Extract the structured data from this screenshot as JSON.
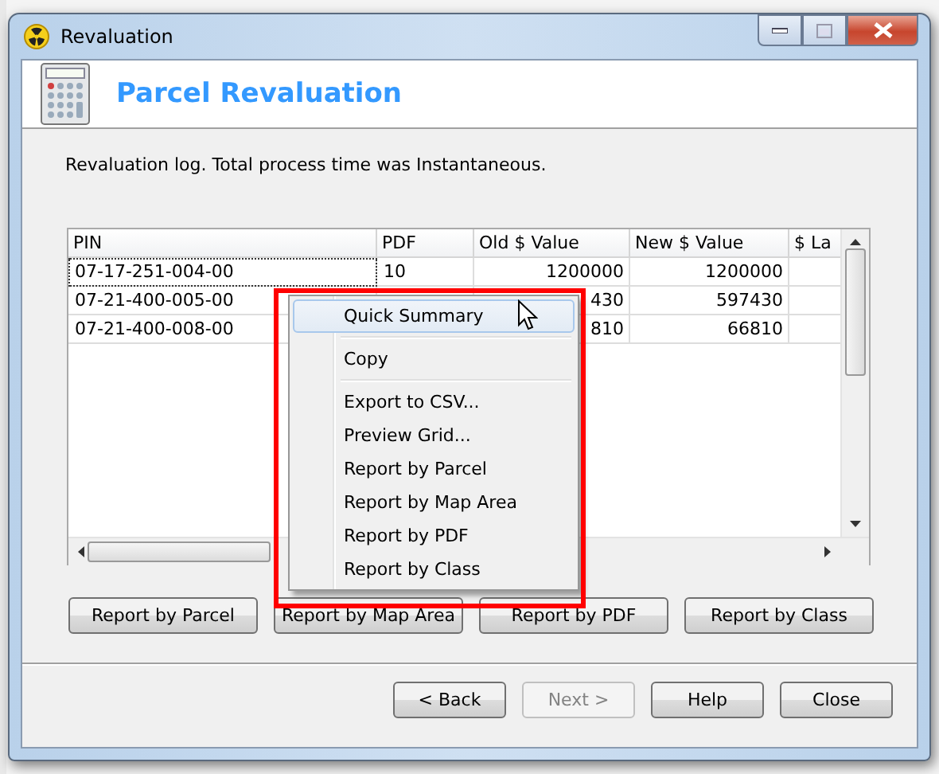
{
  "window": {
    "title": "Revaluation"
  },
  "header": {
    "title": "Parcel Revaluation"
  },
  "message": "Revaluation log. Total process time was Instantaneous.",
  "grid": {
    "columns": [
      "PIN",
      "PDF",
      "Old $ Value",
      "New $ Value",
      "$ La"
    ],
    "rows": [
      {
        "pin": "07-17-251-004-00",
        "pdf": "10",
        "old_value": "1200000",
        "new_value": "1200000",
        "focused": true
      },
      {
        "pin": "07-21-400-005-00",
        "old_value": "430",
        "new_value": "597430",
        "focused": false
      },
      {
        "pin": "07-21-400-008-00",
        "old_value": "810",
        "new_value": "66810",
        "focused": false
      }
    ]
  },
  "context_menu": [
    {
      "kind": "item",
      "label": "Quick Summary",
      "selected": true
    },
    {
      "kind": "separator"
    },
    {
      "kind": "item",
      "label": "Copy",
      "selected": false
    },
    {
      "kind": "separator"
    },
    {
      "kind": "item",
      "label": "Export to CSV...",
      "selected": false
    },
    {
      "kind": "item",
      "label": "Preview Grid...",
      "selected": false
    },
    {
      "kind": "item",
      "label": "Report by Parcel",
      "selected": false
    },
    {
      "kind": "item",
      "label": "Report by Map Area",
      "selected": false
    },
    {
      "kind": "item",
      "label": "Report by PDF",
      "selected": false
    },
    {
      "kind": "item",
      "label": "Report by Class",
      "selected": false
    }
  ],
  "report_buttons": [
    "Report by Parcel",
    "Report by Map Area",
    "Report by PDF",
    "Report by Class"
  ],
  "nav_buttons": [
    {
      "label": "< Back",
      "disabled": false
    },
    {
      "label": "Next >",
      "disabled": true
    },
    {
      "label": "Help",
      "disabled": false
    },
    {
      "label": "Close",
      "disabled": false
    }
  ]
}
